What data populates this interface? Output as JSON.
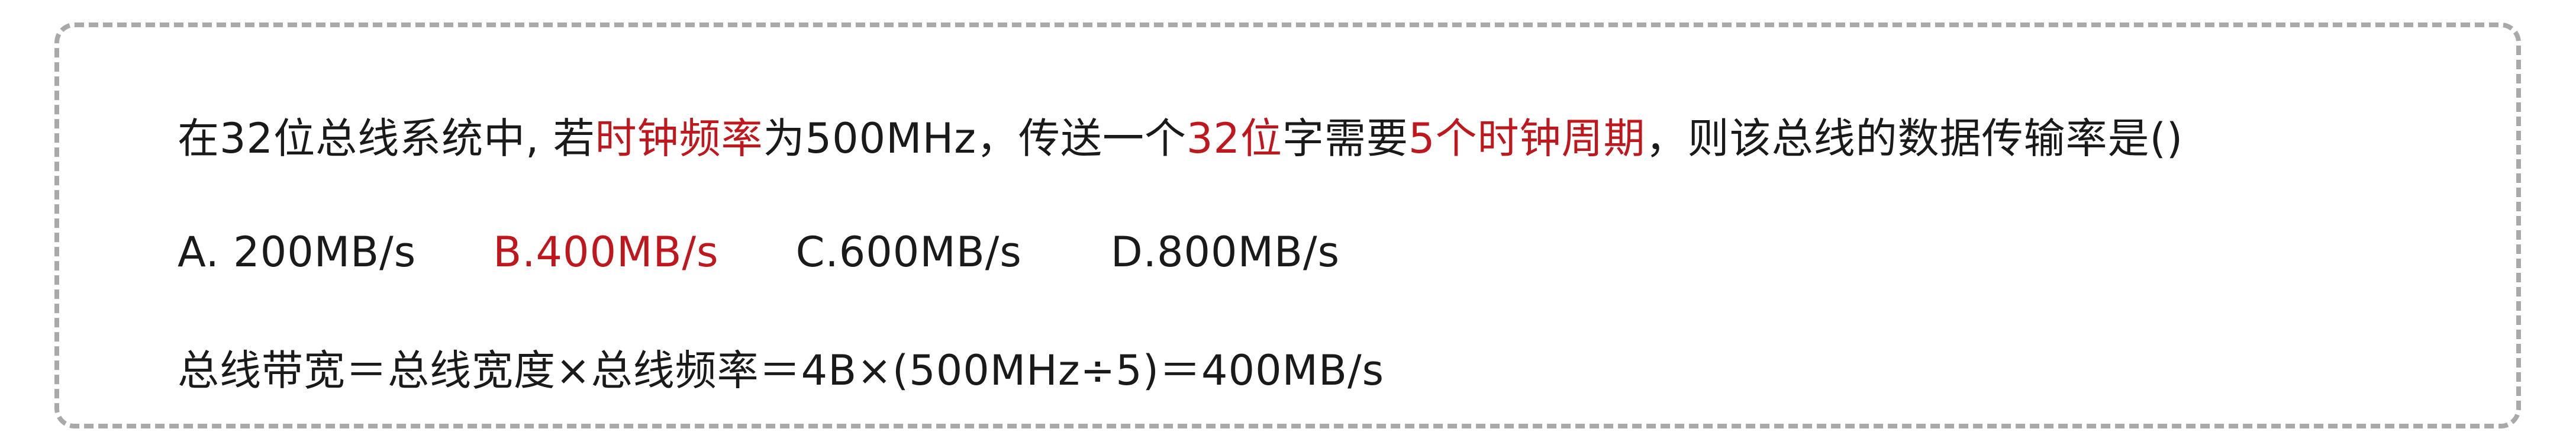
{
  "question": {
    "parts": [
      {
        "text": "在32位总线系统中, 若",
        "highlight": false
      },
      {
        "text": "时钟频率",
        "highlight": true
      },
      {
        "text": "为500MHz，传送一个",
        "highlight": false
      },
      {
        "text": "32位",
        "highlight": true
      },
      {
        "text": "字需要",
        "highlight": false
      },
      {
        "text": "5个时钟周期",
        "highlight": true
      },
      {
        "text": "，则该总线的数据传输率是()",
        "highlight": false
      }
    ]
  },
  "options": [
    {
      "text": "A.  200MB/s",
      "highlight": false
    },
    {
      "text": "B.400MB/s",
      "highlight": true
    },
    {
      "text": "C.600MB/s",
      "highlight": false
    },
    {
      "text": "D.800MB/s",
      "highlight": false
    }
  ],
  "explanation": "总线带宽＝总线宽度×总线频率＝4B×(500MHz÷5)＝400MB/s",
  "colors": {
    "text": "#1a1a1a",
    "highlight": "#c0171d",
    "border": "#a9a9a9"
  }
}
